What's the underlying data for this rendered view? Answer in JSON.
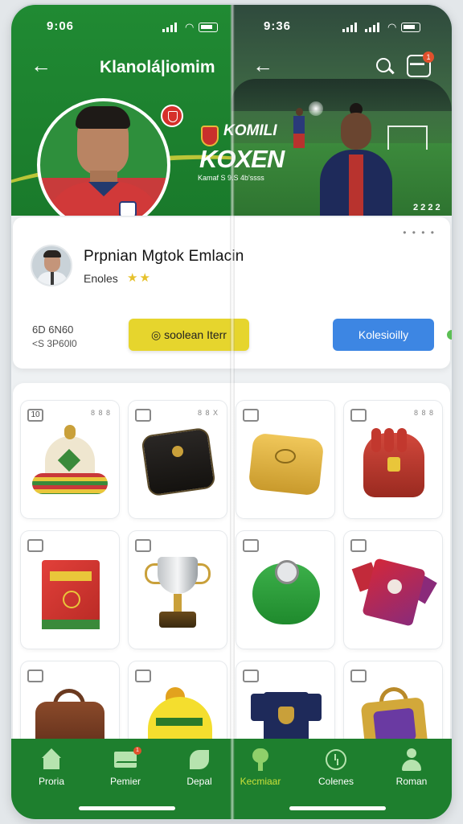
{
  "status": {
    "left_time": "9:06",
    "right_time": "9:36"
  },
  "header": {
    "title": "Klanolá|iomim",
    "cart_label": "▬▬",
    "cart_badge": "1"
  },
  "promo": {
    "line1": "KOMILI",
    "line2": "KOXEN",
    "line3": "Kamaf S 9.S 4b'ssss",
    "score": "2 2 2 2"
  },
  "profile": {
    "name": "Prpnian Mgtok Emlacin",
    "subtitle": "Enoles",
    "stars": "★★",
    "dots": "• • • •",
    "stat1": "6D 6N60",
    "stat2": "<S 3P60l0",
    "primary_button": "◎ soolean Iterr",
    "secondary_button": "Kolesioilly"
  },
  "items": [
    {
      "check": "10",
      "meta": "8 8 8"
    },
    {
      "check": "",
      "meta": "8 8 X"
    },
    {
      "check": "",
      "meta": ""
    },
    {
      "check": "",
      "meta": "8 8 8"
    },
    {
      "check": "",
      "meta": ""
    },
    {
      "check": "",
      "meta": ""
    },
    {
      "check": "",
      "meta": ""
    },
    {
      "check": "",
      "meta": ""
    },
    {
      "check": "",
      "meta": ""
    },
    {
      "check": "",
      "meta": ""
    },
    {
      "check": "",
      "meta": ""
    },
    {
      "check": "",
      "meta": ""
    }
  ],
  "nav": {
    "home": "Proria",
    "mail": "Pemier",
    "mail_badge": "1",
    "leaf": "Depal",
    "tree": "Kecmiaar",
    "clock": "Colenes",
    "person": "Roman"
  },
  "colors": {
    "primary_green": "#1e7f2e",
    "accent_yellow": "#e6d52d",
    "accent_blue": "#3d86e3"
  }
}
